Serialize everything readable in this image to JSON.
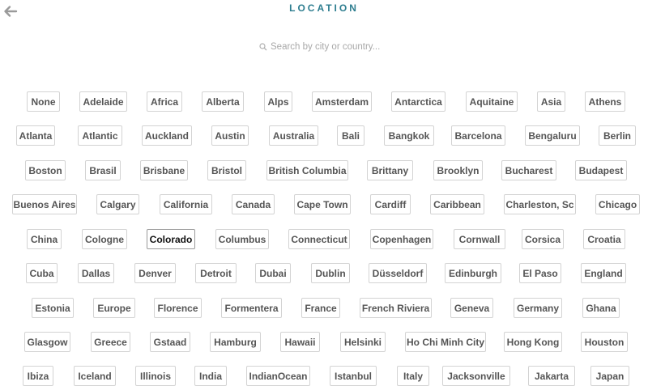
{
  "header": {
    "title": "LOCATION",
    "back_icon": "arrow-left-icon"
  },
  "search": {
    "placeholder": "Search by city or country...",
    "value": "",
    "icon": "search-icon"
  },
  "colors": {
    "accent": "#2d7d8f",
    "tag_border": "#d3d3d3",
    "tag_text": "#555555"
  },
  "selected": "Colorado",
  "locations": [
    [
      "None",
      "Adelaide",
      "Africa",
      "Alberta",
      "Alps",
      "Amsterdam",
      "Antarctica",
      "Aquitaine",
      "Asia",
      "Athens"
    ],
    [
      "Atlanta",
      "Atlantic",
      "Auckland",
      "Austin",
      "Australia",
      "Bali",
      "Bangkok",
      "Barcelona",
      "Bengaluru",
      "Berlin"
    ],
    [
      "Boston",
      "Brasil",
      "Brisbane",
      "Bristol",
      "British Columbia",
      "Brittany",
      "Brooklyn",
      "Bucharest",
      "Budapest"
    ],
    [
      "Buenos Aires",
      "Calgary",
      "California",
      "Canada",
      "Cape Town",
      "Cardiff",
      "Caribbean",
      "Charleston, Sc",
      "Chicago"
    ],
    [
      "China",
      "Cologne",
      "Colorado",
      "Columbus",
      "Connecticut",
      "Copenhagen",
      "Cornwall",
      "Corsica",
      "Croatia"
    ],
    [
      "Cuba",
      "Dallas",
      "Denver",
      "Detroit",
      "Dubai",
      "Dublin",
      "Düsseldorf",
      "Edinburgh",
      "El Paso",
      "England"
    ],
    [
      "Estonia",
      "Europe",
      "Florence",
      "Formentera",
      "France",
      "French Riviera",
      "Geneva",
      "Germany",
      "Ghana"
    ],
    [
      "Glasgow",
      "Greece",
      "Gstaad",
      "Hamburg",
      "Hawaii",
      "Helsinki",
      "Ho Chi Minh City",
      "Hong Kong",
      "Houston"
    ],
    [
      "Ibiza",
      "Iceland",
      "Illinois",
      "India",
      "IndianOcean",
      "Istanbul",
      "Italy",
      "Jacksonville",
      "Jakarta",
      "Japan"
    ]
  ]
}
